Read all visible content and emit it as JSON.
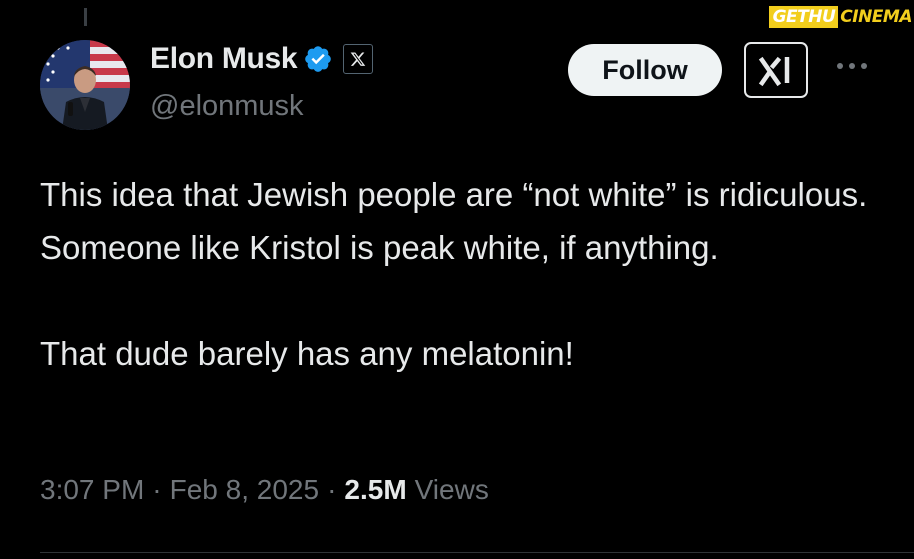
{
  "watermark": {
    "part_a": "GETHU",
    "part_b": "CINEMA"
  },
  "author": {
    "name": "Elon Musk",
    "handle": "@elonmusk",
    "verified_icon": "verified-badge-icon",
    "affiliation_icon": "x-logo-icon",
    "avatar_icon": "avatar-photo"
  },
  "actions": {
    "follow_label": "Follow",
    "grok_icon": "grok-icon",
    "more_icon": "more-dots-icon"
  },
  "tweet": {
    "paragraph_1": "This idea that Jewish people are “not white” is ridiculous. Someone like Kristol is peak white, if anything.",
    "paragraph_2": "That dude barely has any melatonin!"
  },
  "meta": {
    "time": "3:07 PM",
    "separator": "·",
    "date": "Feb 8, 2025",
    "views_count": "2.5M",
    "views_label": "Views"
  },
  "colors": {
    "background": "#000000",
    "text_primary": "#e7e9ea",
    "text_secondary": "#71767b",
    "verified_blue": "#1d9bf0",
    "watermark_yellow": "#f2ce1d",
    "follow_button_bg": "#eff3f4"
  }
}
